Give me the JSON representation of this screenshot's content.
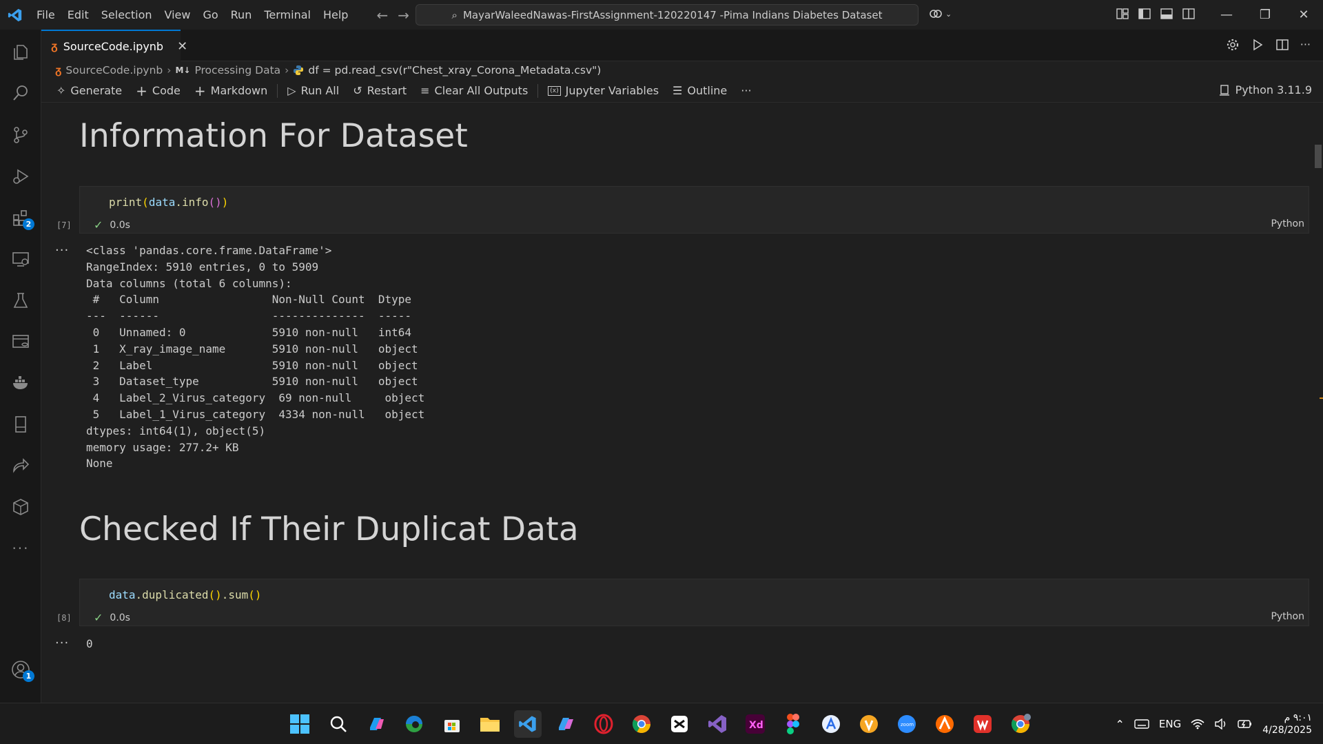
{
  "titlebar": {
    "menu": [
      "File",
      "Edit",
      "Selection",
      "View",
      "Go",
      "Run",
      "Terminal",
      "Help"
    ],
    "search_text": "MayarWaleedNawas-FirstAssignment-120220147 -Pima Indians Diabetes Dataset"
  },
  "activity_bar": {
    "extensions_badge": "2",
    "accounts_badge": "1"
  },
  "tab": {
    "label": "SourceCode.ipynb"
  },
  "breadcrumb": {
    "file": "SourceCode.ipynb",
    "md_tag": "M↓",
    "section": "Processing Data",
    "symbol": "df = pd.read_csv(r\"Chest_xray_Corona_Metadata.csv\")"
  },
  "toolbar": {
    "generate": "Generate",
    "code": "Code",
    "markdown": "Markdown",
    "run_all": "Run All",
    "restart": "Restart",
    "clear_outputs": "Clear All Outputs",
    "jupyter_variables": "Jupyter Variables",
    "outline": "Outline",
    "more": "···",
    "kernel": "Python 3.11.9"
  },
  "notebook": {
    "heading1": "Information For Dataset",
    "cell1": {
      "count": "[7]",
      "time": "0.0s",
      "lang": "Python",
      "code_fn": "print",
      "code_var": "data",
      "code_method": ".info"
    },
    "output1": [
      "<class 'pandas.core.frame.DataFrame'>",
      "RangeIndex: 5910 entries, 0 to 5909",
      "Data columns (total 6 columns):",
      " #   Column                 Non-Null Count  Dtype ",
      "---  ------                 --------------  ----- ",
      " 0   Unnamed: 0             5910 non-null   int64 ",
      " 1   X_ray_image_name       5910 non-null   object",
      " 2   Label                  5910 non-null   object",
      " 3   Dataset_type           5910 non-null   object",
      " 4   Label_2_Virus_category  69 non-null     object",
      " 5   Label_1_Virus_category  4334 non-null   object",
      "dtypes: int64(1), object(5)",
      "memory usage: 277.2+ KB",
      "None"
    ],
    "heading2": "Checked If Their Duplicat Data",
    "cell2": {
      "count": "[8]",
      "time": "0.0s",
      "lang": "Python",
      "code_var": "data",
      "code_method": ".duplicated",
      "code_sum": ".sum"
    },
    "output2": "0",
    "out_dots": "···"
  },
  "tray": {
    "lang": "ENG",
    "time": "٩:٠١ م",
    "date": "4/28/2025"
  }
}
